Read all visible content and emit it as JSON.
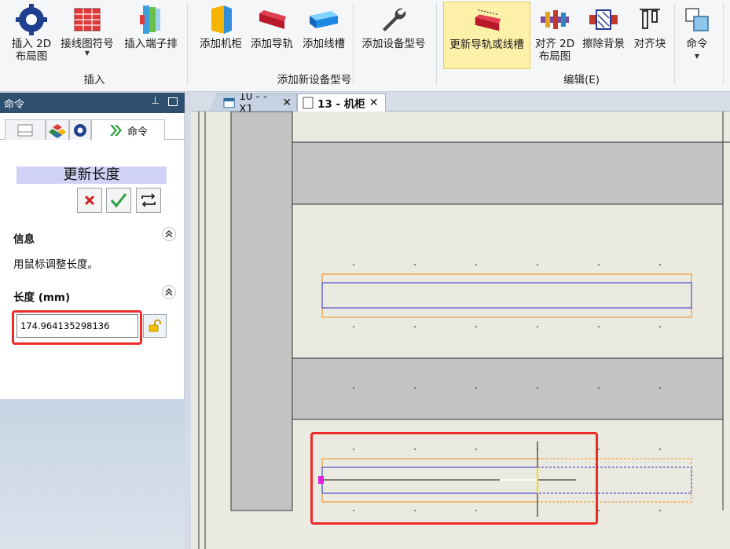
{
  "ribbon": {
    "buttons": [
      {
        "id": "insert-2d-layout",
        "label1": "插入 2D",
        "label2": "布局图",
        "icon": "gear-icon"
      },
      {
        "id": "wire-symbol",
        "label1": "接线图符号",
        "label2": "",
        "icon": "wiring-table-icon"
      },
      {
        "id": "insert-terminal-strip",
        "label1": "插入端子排",
        "label2": "",
        "icon": "terminal-strip-icon"
      },
      {
        "id": "add-cabinet",
        "label1": "添加机柜",
        "label2": "",
        "icon": "cabinet-icon"
      },
      {
        "id": "add-rail",
        "label1": "添加导轨",
        "label2": "",
        "icon": "rail-icon"
      },
      {
        "id": "add-duct",
        "label1": "添加线槽",
        "label2": "",
        "icon": "duct-icon"
      },
      {
        "id": "add-device-model",
        "label1": "添加设备型号",
        "label2": "",
        "icon": "wrench-icon"
      },
      {
        "id": "update-rail-duct",
        "label1": "更新导轨或线槽",
        "label2": "",
        "icon": "update-rail-icon"
      },
      {
        "id": "align-2d-layout",
        "label1": "对齐 2D",
        "label2": "布局图",
        "icon": "align-layout-icon"
      },
      {
        "id": "erase-background",
        "label1": "擦除背景",
        "label2": "",
        "icon": "erase-background-icon"
      },
      {
        "id": "align-block",
        "label1": "对齐块",
        "label2": "",
        "icon": "align-block-icon"
      },
      {
        "id": "command",
        "label1": "命令",
        "label2": "",
        "icon": "command-icon"
      }
    ],
    "groups": {
      "insert": "插入",
      "add_new_device_model": "添加新设备型号",
      "edit": "编辑(E)"
    }
  },
  "panel": {
    "title": "命令",
    "tab_command": "命令",
    "heading": "更新长度",
    "info_section": "信息",
    "info_text": "用鼠标调整长度。",
    "length_section": "长度 (mm)",
    "length_value": "174.964135298136"
  },
  "doc_tabs": [
    {
      "label": "10 - -X1",
      "active": false
    },
    {
      "label": "13 - 机柜",
      "active": true
    }
  ],
  "colors": {
    "ribbon_active_bg": "#fdf0a8",
    "panel_header": "#2f4f6f",
    "canvas_bg": "#ebeae0",
    "highlight_red": "#ee2b2b",
    "rail_outline": "#2b2bcc",
    "duct_outline": "#f08c1a"
  }
}
